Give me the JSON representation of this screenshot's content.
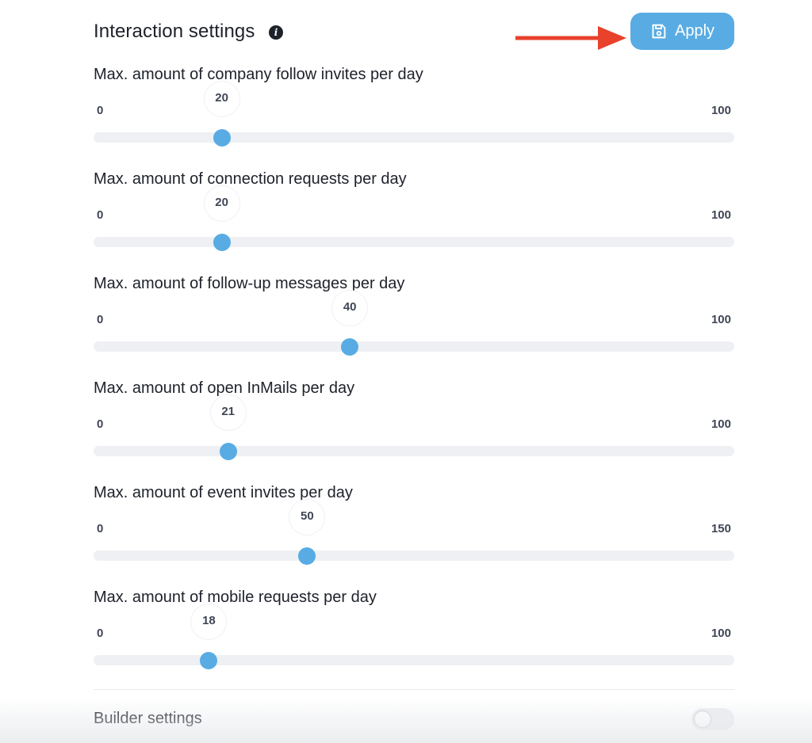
{
  "header": {
    "title": "Interaction settings",
    "info_icon": "info-icon",
    "apply_label": "Apply",
    "apply_icon": "save-icon",
    "annotation_arrow_color": "#e8412c"
  },
  "colors": {
    "accent": "#58ace3",
    "track": "#eef0f3",
    "text": "#1d2129"
  },
  "sliders": [
    {
      "label": "Max. amount of company follow invites per day",
      "min": "0",
      "max": "100",
      "value": "20"
    },
    {
      "label": "Max. amount of connection requests per day",
      "min": "0",
      "max": "100",
      "value": "20"
    },
    {
      "label": "Max. amount of follow-up messages per day",
      "min": "0",
      "max": "100",
      "value": "40"
    },
    {
      "label": "Max. amount of open InMails per day",
      "min": "0",
      "max": "100",
      "value": "21"
    },
    {
      "label": "Max. amount of event invites per day",
      "min": "0",
      "max": "150",
      "value": "50"
    },
    {
      "label": "Max. amount of mobile requests per day",
      "min": "0",
      "max": "100",
      "value": "18"
    }
  ],
  "builder": {
    "label": "Builder settings",
    "toggle_on": false
  }
}
